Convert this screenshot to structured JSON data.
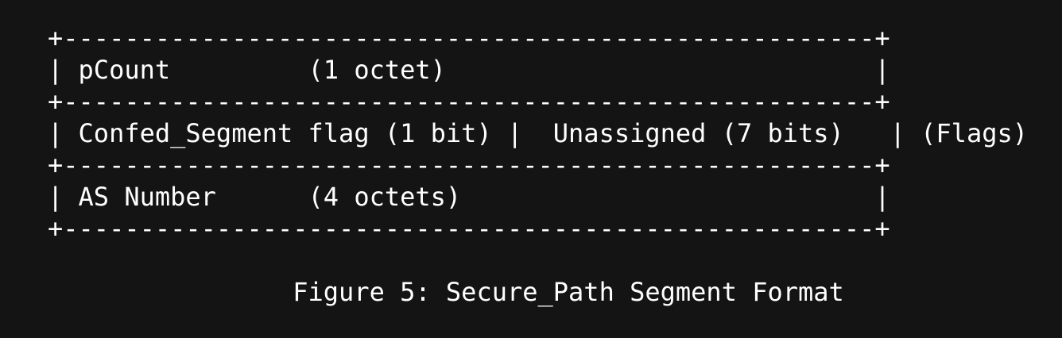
{
  "diagram": {
    "border_top": "+-----------------------------------------------------+",
    "row_pcount": "| pCount         (1 octet)                            |",
    "border_2": "+-----------------------------------------------------+",
    "row_flags": "| Confed_Segment flag (1 bit) |  Unassigned (7 bits)   | (Flags)",
    "border_3": "+-----------------------------------------------------+",
    "row_as_number": "| AS Number      (4 octets)                           |",
    "border_bottom": "+-----------------------------------------------------+"
  },
  "caption": "                Figure 5: Secure_Path Segment Format",
  "colors": {
    "background": "#141414",
    "text": "#ffffff"
  }
}
